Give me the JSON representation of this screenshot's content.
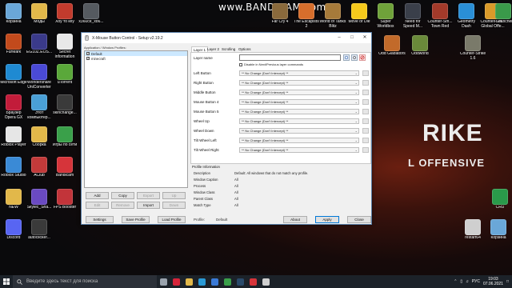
{
  "watermark": "www.BANDICAM.com",
  "wallpaper": {
    "title": "RIKE",
    "subtitle": "L OFFENSIVE"
  },
  "desktop_icons": [
    {
      "label": "Корзина",
      "color": "#6aa7d8"
    },
    {
      "label": "Моды",
      "color": "#e2b84a"
    },
    {
      "label": "Хоу то кеу",
      "color": "#c23b2d"
    },
    {
      "label": "x360ce_x86...",
      "color": "#555a60"
    },
    {
      "label": "Far Cry 4",
      "color": "#8a6a3c"
    },
    {
      "label": "The Escapists 2",
      "color": "#d66e2c"
    },
    {
      "label": "World of Tanks Blitz",
      "color": "#a67a3a"
    },
    {
      "label": "Move or Die",
      "color": "#f5c91c"
    },
    {
      "label": "Super Worldbox",
      "color": "#6fa23a"
    },
    {
      "label": "Need for Speed M...",
      "color": "#3a3f4a"
    },
    {
      "label": "Counter-Stri... Town Red",
      "color": "#a33a2a"
    },
    {
      "label": "Geometry Dash",
      "color": "#2a8fd6"
    },
    {
      "label": "Counter-Stri... Global Offe...",
      "color": "#d99a2a"
    },
    {
      "label": "TLauncher",
      "color": "#3a9a4a"
    },
    {
      "label": "FurMark",
      "color": "#c24a1c"
    },
    {
      "label": "EG10Z.EOS...",
      "color": "#3a3a8a"
    },
    {
      "label": "Secret information",
      "color": "#e8e8e8"
    },
    {
      "label": "Microsoft Edge",
      "color": "#1f8ad2"
    },
    {
      "label": "Wondershare UniConverter",
      "color": "#4a4ad6"
    },
    {
      "label": "uTorrent",
      "color": "#5aa83a"
    },
    {
      "label": "Этот компьютер...",
      "color": "#4aa0d6"
    },
    {
      "label": "skinchange...",
      "color": "#3a3a3a"
    },
    {
      "label": "Браузер Opera GX",
      "color": "#c21c3a"
    },
    {
      "label": "Roblox Player",
      "color": "#e6e6e6"
    },
    {
      "label": "Сборка",
      "color": "#e2b84a"
    },
    {
      "label": "Игры по сети",
      "color": "#3aa04a"
    },
    {
      "label": "Roblox Studio",
      "color": "#3a8ad6"
    },
    {
      "label": "AClub",
      "color": "#c23a3a"
    },
    {
      "label": "Bandicam",
      "color": "#d6343a"
    },
    {
      "label": "NEW",
      "color": "#e2b84a"
    },
    {
      "label": "Skylec_Sha...",
      "color": "#6a4ac2"
    },
    {
      "label": "FPS Booster",
      "color": "#c2343a"
    },
    {
      "label": "Discord",
      "color": "#5865f2"
    },
    {
      "label": "autoclicker...",
      "color": "#3a3a3a"
    },
    {
      "label": "Odd Gladiators",
      "color": "#c26a2a"
    },
    {
      "label": "Counter-Strike 1.6",
      "color": "#7a7a6a"
    },
    {
      "label": "Oddworld",
      "color": "#6a8a3a"
    },
    {
      "label": "CRU",
      "color": "#2a9a4a"
    },
    {
      "label": "restart64",
      "color": "#cfcfcf"
    },
    {
      "label": "Корзина",
      "color": "#6aa7d8"
    }
  ],
  "window": {
    "title": "X-Mouse Button Control - Setup v2.19.2",
    "profiles_label": "Application / Window Profiles:",
    "profiles": [
      {
        "name": "Default",
        "checked": true,
        "selected": true
      },
      {
        "name": "minecraft",
        "checked": true,
        "selected": false
      }
    ],
    "profile_buttons": {
      "add": "Add",
      "copy": "Copy",
      "export": "Export",
      "up": "Up",
      "edit": "Edit",
      "remove": "Remove",
      "import": "Import",
      "down": "Down"
    },
    "tabs": [
      "Layer 1",
      "Layer 2",
      "Scrolling",
      "Options"
    ],
    "layer_name_label": "Layer name",
    "layer_name_value": "",
    "disable_checkbox_label": "Disable in Next/Previous layer commands",
    "button_rows": [
      {
        "label": "Left Button",
        "value": "** No Change (Don't Intercept) **"
      },
      {
        "label": "Right Button",
        "value": "** No Change (Don't Intercept) **"
      },
      {
        "label": "Middle Button",
        "value": "** No Change (Don't Intercept) **"
      },
      {
        "label": "Mouse Button 4",
        "value": "** No Change (Don't Intercept) **"
      },
      {
        "label": "Mouse Button 5",
        "value": "** No Change (Don't Intercept) **"
      },
      {
        "label": "Wheel Up",
        "value": "** No Change (Don't Intercept) **"
      },
      {
        "label": "Wheel Down",
        "value": "** No Change (Don't Intercept) **"
      },
      {
        "label": "Tilt Wheel Left",
        "value": "** No Change (Don't Intercept) **"
      },
      {
        "label": "Tilt Wheel Right",
        "value": "** No Change (Don't Intercept) **"
      }
    ],
    "profile_info_label": "Profile Information",
    "profile_info": [
      {
        "key": "Description",
        "value": "Default: All windows that do not match any profile."
      },
      {
        "key": "Window Caption",
        "value": "All"
      },
      {
        "key": "Process",
        "value": "All"
      },
      {
        "key": "Window Class",
        "value": "All"
      },
      {
        "key": "Parent Class",
        "value": "All"
      },
      {
        "key": "Match Type",
        "value": "All"
      }
    ],
    "footer": {
      "settings": "Settings",
      "save_profile": "Save Profile",
      "load_profile": "Load Profile",
      "profile_label": "Profile:",
      "profile_value": "Default",
      "about": "About",
      "apply": "Apply",
      "close": "Close"
    }
  },
  "taskbar": {
    "search_placeholder": "Введите здесь текст для поиска",
    "apps": [
      {
        "name": "task-view",
        "color": "#9aa3ad"
      },
      {
        "name": "opera-gx",
        "color": "#d6243a"
      },
      {
        "name": "explorer",
        "color": "#e2b84a"
      },
      {
        "name": "edge",
        "color": "#2a9ad6"
      },
      {
        "name": "store",
        "color": "#3a7ad6"
      },
      {
        "name": "chrome",
        "color": "#3aa04a"
      },
      {
        "name": "steam",
        "color": "#2a4a6a"
      },
      {
        "name": "bandicam",
        "color": "#d6343a"
      },
      {
        "name": "xmouse",
        "color": "#cfcfcf"
      }
    ],
    "lang": "РУС",
    "time": "19:03",
    "date": "07.06.2021"
  }
}
